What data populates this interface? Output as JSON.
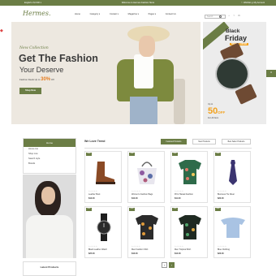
{
  "topbar": {
    "left": "English ▾   $ USD ▾",
    "center": "Welcome to Hermes Fashion Store",
    "right": "♡ Wishlist   ◎ My Account"
  },
  "header": {
    "logo": "Hermes.",
    "nav": [
      "Home",
      "Category ▾",
      "Contact ▾",
      "Magazine ▾",
      "Pages ▾",
      "Contact Us"
    ],
    "search_placeholder": "Search"
  },
  "hero": {
    "subtitle": "New Collection",
    "title": "Get The Fashion",
    "title2": "Your Deserve",
    "discount_prefix": "Fashion Deals Up to",
    "discount_value": "30%",
    "discount_suffix": "Off",
    "button": "Shop Now"
  },
  "promo": {
    "line1": "Black",
    "line2": "Friday",
    "badge": "SPECIAL OFFER",
    "upto": "Up to",
    "value": "50",
    "value_suffix": "OFF",
    "note": "For All Item"
  },
  "sidebar": {
    "title": "Home",
    "items": [
      "Home one",
      "Shop now",
      "Search style",
      "Brands"
    ]
  },
  "latest_title": "Latest Products",
  "trend": {
    "title": "We Love Trend",
    "tabs": [
      "Featured Products",
      "New Products",
      "Best Seller Products"
    ]
  },
  "products": [
    {
      "badge": "New",
      "name": "Leather Boot",
      "price": "$13.00",
      "stars": "★★★★★"
    },
    {
      "badge": "Sale",
      "name": "Women's Fashion Bags",
      "price": "$10.00",
      "stars": "★★★★★"
    },
    {
      "badge": "New",
      "name": "Print Hawaii Fashion",
      "price": "$11.00",
      "stars": "★★★★★"
    },
    {
      "badge": "New",
      "name": "Business Tie Wear",
      "price": "$20.00",
      "stars": "★★★★★"
    },
    {
      "badge": "New",
      "name": "Black Leather Watch",
      "price": "$25.00",
      "stars": "★★★★★"
    },
    {
      "badge": "New",
      "name": "Men Fashion Shirt",
      "price": "$16.00",
      "stars": "★★★★★"
    },
    {
      "badge": "Sale",
      "name": "Men Tropical Shirt",
      "price": "$12.00",
      "stars": "★★★★★"
    },
    {
      "badge": "New",
      "name": "Blue Clothing",
      "price": "$23.00",
      "stars": "★★★★★"
    }
  ],
  "pager": {
    "prev": "‹",
    "next": "›"
  },
  "colors": {
    "accent": "#6b7d45",
    "highlight": "#f2a21f"
  }
}
